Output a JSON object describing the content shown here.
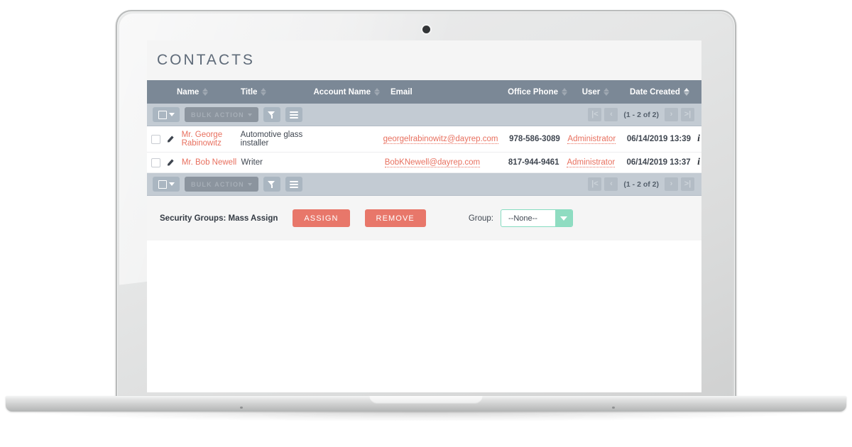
{
  "device": {
    "type": "laptop-mockup",
    "webcam": "webcam-dot"
  },
  "page": {
    "title": "CONTACTS"
  },
  "table": {
    "columns": [
      {
        "key": "name",
        "label": "Name",
        "sortable": true,
        "sort": "none"
      },
      {
        "key": "title",
        "label": "Title",
        "sortable": true,
        "sort": "none"
      },
      {
        "key": "account_name",
        "label": "Account Name",
        "sortable": true,
        "sort": "none"
      },
      {
        "key": "email",
        "label": "Email",
        "sortable": false,
        "sort": "none"
      },
      {
        "key": "office_phone",
        "label": "Office Phone",
        "sortable": true,
        "sort": "none"
      },
      {
        "key": "user",
        "label": "User",
        "sortable": true,
        "sort": "none"
      },
      {
        "key": "date_created",
        "label": "Date Created",
        "sortable": true,
        "sort": "asc"
      }
    ],
    "rows": [
      {
        "name": "Mr. George Rabinowitz",
        "title": "Automotive glass installer",
        "account_name": "",
        "email": "georgelrabinowitz@dayrep.com",
        "office_phone": "978-586-3089",
        "user": "Administrator",
        "date_created": "06/14/2019 13:39",
        "info": "i"
      },
      {
        "name": "Mr. Bob Newell",
        "title": "Writer",
        "account_name": "",
        "email": "BobKNewell@dayrep.com",
        "office_phone": "817-944-9461",
        "user": "Administrator",
        "date_created": "06/14/2019 13:37",
        "info": "i"
      }
    ]
  },
  "toolbar": {
    "select_all_label": "",
    "bulk_action_label": "BULK ACTION",
    "filter_icon": "funnel-icon",
    "columns_icon": "list-icon",
    "pager": {
      "first": "|<",
      "prev": "‹",
      "label": "(1 - 2 of 2)",
      "next": "›",
      "last": ">|"
    }
  },
  "mass_assign": {
    "label": "Security Groups: Mass Assign",
    "assign_label": "ASSIGN",
    "remove_label": "REMOVE",
    "group_label": "Group:",
    "group_value": "--None--",
    "group_options": [
      "--None--"
    ]
  },
  "colors": {
    "header_bg": "#7b8896",
    "toolbar_bg": "#c3cbd3",
    "accent_link": "#e8705f",
    "action_button": "#e8776a",
    "select_border": "#86dcc0",
    "select_arrow": "#8fdcc1",
    "page_title": "#5e6a78"
  }
}
